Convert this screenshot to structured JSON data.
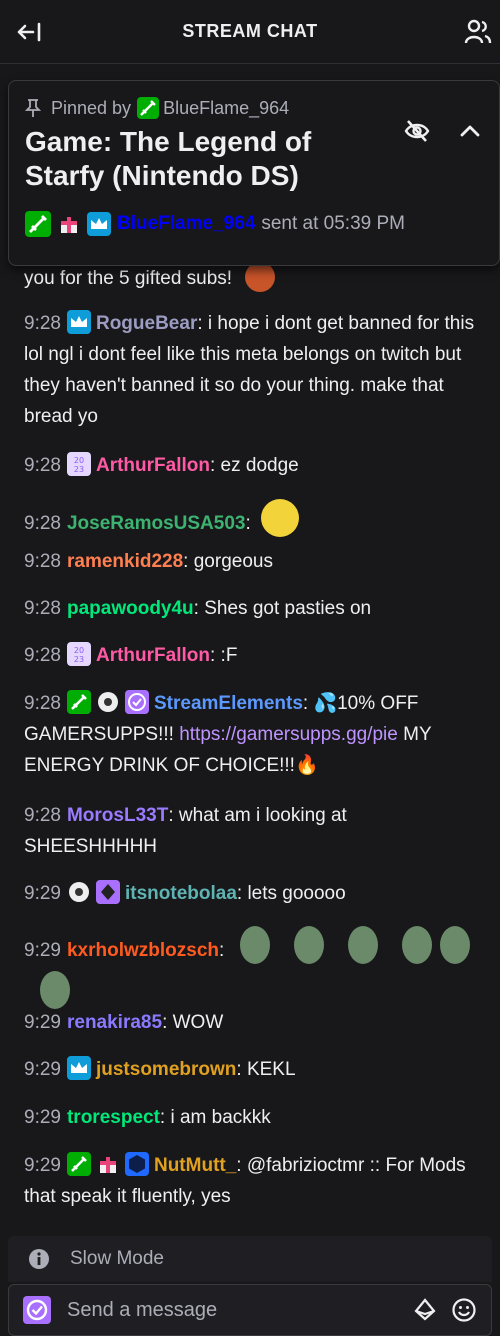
{
  "header": {
    "title": "STREAM CHAT",
    "collapse_icon": "arrow-collapse-icon",
    "users_icon": "community-icon"
  },
  "pinned": {
    "label_prefix": "Pinned by",
    "pinned_by": "BlueFlame_964",
    "title": "Game: The Legend of Starfy (Nintendo DS)",
    "sender": "BlueFlame_964",
    "sent_text": "sent at 05:39 PM"
  },
  "messages": [
    {
      "partial_text": "you for the 5 gifted subs!"
    },
    {
      "time": "9:28",
      "user": "RogueBear",
      "color": "#ff6347",
      "text": ": i hope i dont get banned for this lol ngl i dont feel like this meta belongs on twitch but they haven't banned it so do your thing. make that bread yo"
    },
    {
      "time": "9:28",
      "user": "ArthurFallon",
      "color": "#ff69b4",
      "text": ": ez dodge"
    },
    {
      "time": "9:28",
      "user": "JoseRamosUSA503",
      "color": "#2e8b57",
      "text": ":"
    },
    {
      "time": "9:28",
      "user": "ramenkid228",
      "color": "#ff7f50",
      "text": ": gorgeous"
    },
    {
      "time": "9:28",
      "user": "papawoody4u",
      "color": "#00ff7f",
      "text": ": Shes got pasties on"
    },
    {
      "time": "9:28",
      "user": "ArthurFallon",
      "color": "#ff69b4",
      "text": ": :F"
    },
    {
      "time": "9:28",
      "user": "StreamElements",
      "color": "#5b99ff",
      "text": ": 💦10% OFF GAMERSUPPS!!! ",
      "link": "https://gamersupps.gg/pie",
      "text_after": " MY ENERGY DRINK OF CHOICE!!!🔥"
    },
    {
      "time": "9:28",
      "user": "MorosL33T",
      "color": "#8a2be2",
      "text": ": what am i looking at SHEESHHHHH"
    },
    {
      "time": "9:29",
      "user": "itsnotebolaa",
      "color": "#5f9ea0",
      "text": ": lets gooooo"
    },
    {
      "time": "9:29",
      "user": "kxrholwzblozsch",
      "color": "#ff4500",
      "text": ":"
    },
    {
      "time": "9:29",
      "user": "renakira85",
      "color": "#8a2be2",
      "text": ": WOW"
    },
    {
      "time": "9:29",
      "user": "justsomebrown",
      "color": "#daa520",
      "text": ": KEKL"
    },
    {
      "time": "9:29",
      "user": "trorespect",
      "color": "#00ff7f",
      "text": ": i am backkk"
    },
    {
      "time": "9:29",
      "user": "NutMutt_",
      "color": "#daa520",
      "text": ": @fabrizioctmr :: For Mods that speak it fluently, yes"
    }
  ],
  "slow_mode": {
    "label": "Slow Mode",
    "icon": "info-icon"
  },
  "input": {
    "placeholder": "Send a message",
    "left_icon": "sub-badge-icon",
    "bits_icon": "bits-icon",
    "emote_icon": "emote-icon"
  }
}
